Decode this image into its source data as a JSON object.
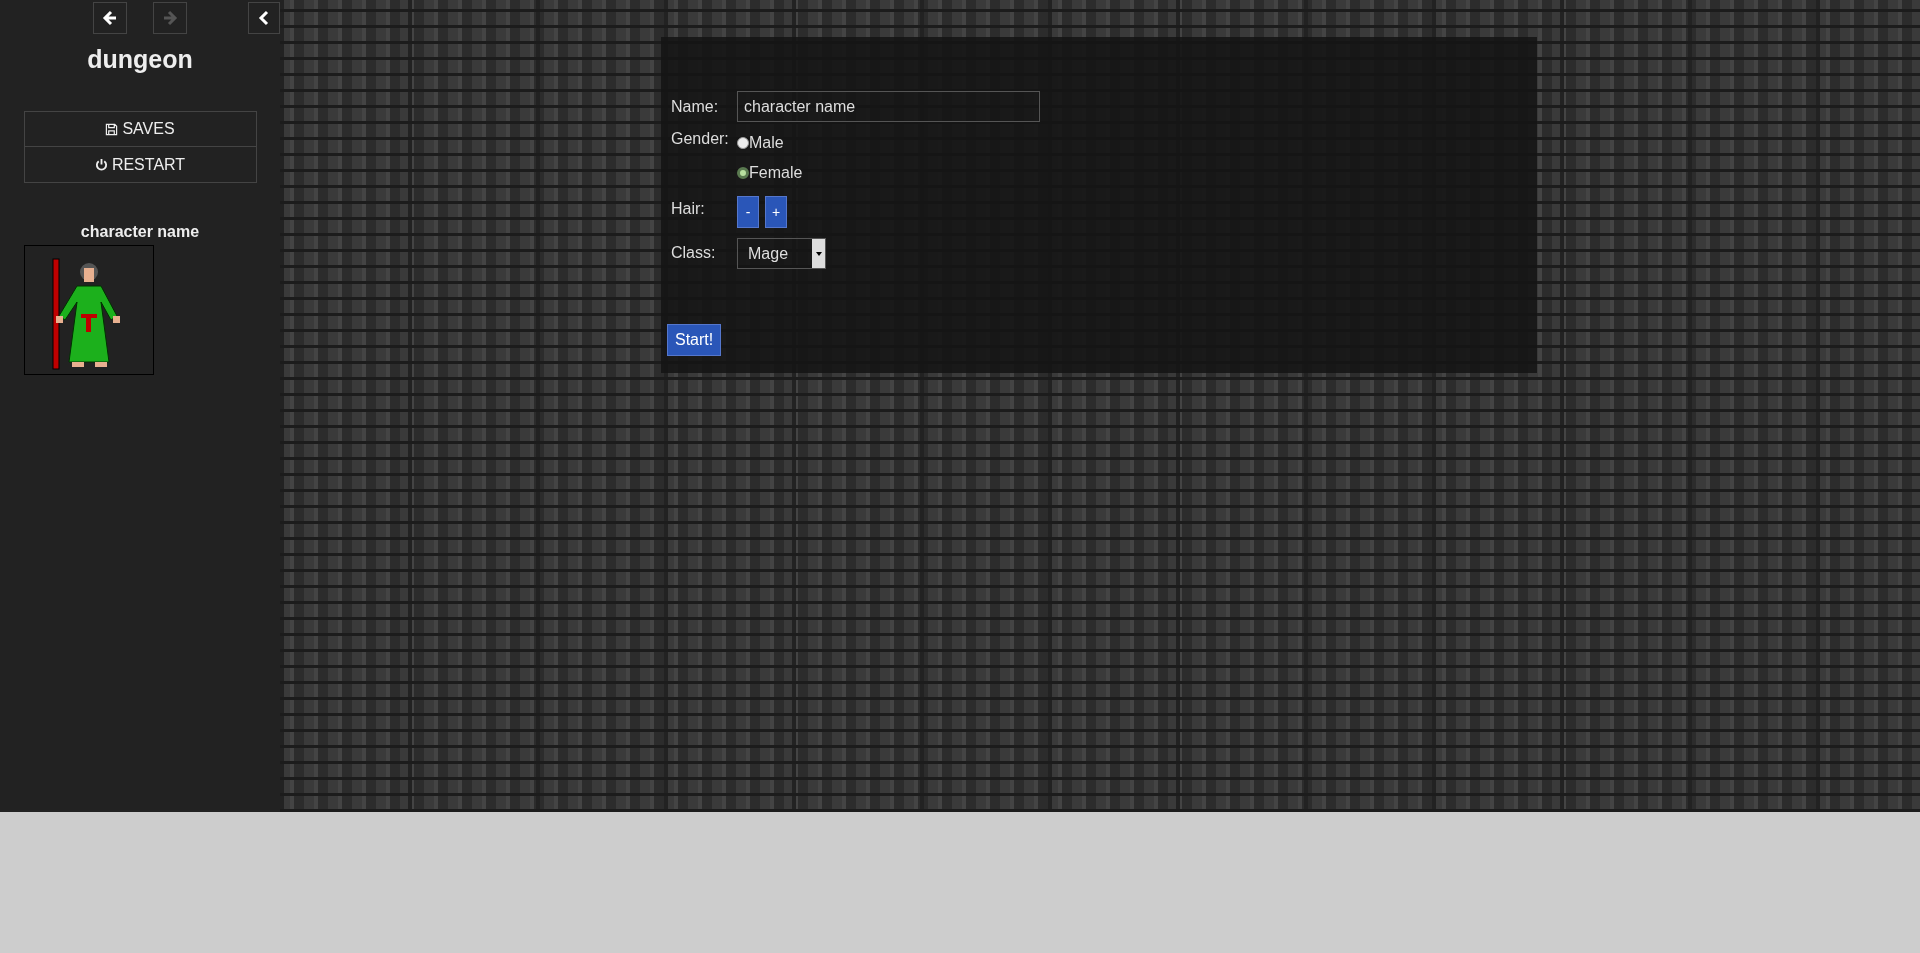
{
  "sidebar": {
    "nav": [
      {
        "kind": "back",
        "disabled": false
      },
      {
        "kind": "forward",
        "disabled": true
      }
    ],
    "title": "dungeon",
    "menu": [
      {
        "kind": "save",
        "label": "SAVES"
      },
      {
        "kind": "power",
        "label": "RESTART"
      }
    ],
    "character": {
      "name": "character name"
    }
  },
  "form": {
    "name": {
      "label": "Name:",
      "value": "character name"
    },
    "gender": {
      "label": "Gender:",
      "options": [
        {
          "label": "Male",
          "selected": false
        },
        {
          "label": "Female",
          "selected": true
        }
      ]
    },
    "hair": {
      "label": "Hair:",
      "buttons": [
        "-",
        "+"
      ]
    },
    "class": {
      "label": "Class:",
      "value": "Mage"
    },
    "start": "Start!"
  }
}
